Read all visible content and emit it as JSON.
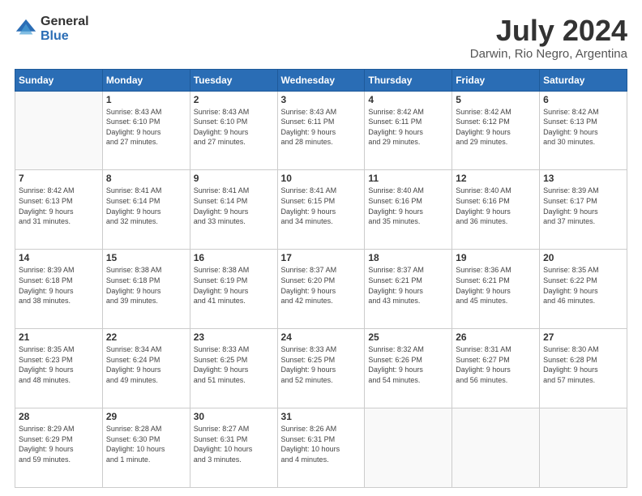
{
  "header": {
    "logo_general": "General",
    "logo_blue": "Blue",
    "title": "July 2024",
    "subtitle": "Darwin, Rio Negro, Argentina"
  },
  "days_of_week": [
    "Sunday",
    "Monday",
    "Tuesday",
    "Wednesday",
    "Thursday",
    "Friday",
    "Saturday"
  ],
  "weeks": [
    [
      {
        "day": "",
        "info": ""
      },
      {
        "day": "1",
        "info": "Sunrise: 8:43 AM\nSunset: 6:10 PM\nDaylight: 9 hours\nand 27 minutes."
      },
      {
        "day": "2",
        "info": "Sunrise: 8:43 AM\nSunset: 6:10 PM\nDaylight: 9 hours\nand 27 minutes."
      },
      {
        "day": "3",
        "info": "Sunrise: 8:43 AM\nSunset: 6:11 PM\nDaylight: 9 hours\nand 28 minutes."
      },
      {
        "day": "4",
        "info": "Sunrise: 8:42 AM\nSunset: 6:11 PM\nDaylight: 9 hours\nand 29 minutes."
      },
      {
        "day": "5",
        "info": "Sunrise: 8:42 AM\nSunset: 6:12 PM\nDaylight: 9 hours\nand 29 minutes."
      },
      {
        "day": "6",
        "info": "Sunrise: 8:42 AM\nSunset: 6:13 PM\nDaylight: 9 hours\nand 30 minutes."
      }
    ],
    [
      {
        "day": "7",
        "info": "Sunrise: 8:42 AM\nSunset: 6:13 PM\nDaylight: 9 hours\nand 31 minutes."
      },
      {
        "day": "8",
        "info": "Sunrise: 8:41 AM\nSunset: 6:14 PM\nDaylight: 9 hours\nand 32 minutes."
      },
      {
        "day": "9",
        "info": "Sunrise: 8:41 AM\nSunset: 6:14 PM\nDaylight: 9 hours\nand 33 minutes."
      },
      {
        "day": "10",
        "info": "Sunrise: 8:41 AM\nSunset: 6:15 PM\nDaylight: 9 hours\nand 34 minutes."
      },
      {
        "day": "11",
        "info": "Sunrise: 8:40 AM\nSunset: 6:16 PM\nDaylight: 9 hours\nand 35 minutes."
      },
      {
        "day": "12",
        "info": "Sunrise: 8:40 AM\nSunset: 6:16 PM\nDaylight: 9 hours\nand 36 minutes."
      },
      {
        "day": "13",
        "info": "Sunrise: 8:39 AM\nSunset: 6:17 PM\nDaylight: 9 hours\nand 37 minutes."
      }
    ],
    [
      {
        "day": "14",
        "info": "Sunrise: 8:39 AM\nSunset: 6:18 PM\nDaylight: 9 hours\nand 38 minutes."
      },
      {
        "day": "15",
        "info": "Sunrise: 8:38 AM\nSunset: 6:18 PM\nDaylight: 9 hours\nand 39 minutes."
      },
      {
        "day": "16",
        "info": "Sunrise: 8:38 AM\nSunset: 6:19 PM\nDaylight: 9 hours\nand 41 minutes."
      },
      {
        "day": "17",
        "info": "Sunrise: 8:37 AM\nSunset: 6:20 PM\nDaylight: 9 hours\nand 42 minutes."
      },
      {
        "day": "18",
        "info": "Sunrise: 8:37 AM\nSunset: 6:21 PM\nDaylight: 9 hours\nand 43 minutes."
      },
      {
        "day": "19",
        "info": "Sunrise: 8:36 AM\nSunset: 6:21 PM\nDaylight: 9 hours\nand 45 minutes."
      },
      {
        "day": "20",
        "info": "Sunrise: 8:35 AM\nSunset: 6:22 PM\nDaylight: 9 hours\nand 46 minutes."
      }
    ],
    [
      {
        "day": "21",
        "info": "Sunrise: 8:35 AM\nSunset: 6:23 PM\nDaylight: 9 hours\nand 48 minutes."
      },
      {
        "day": "22",
        "info": "Sunrise: 8:34 AM\nSunset: 6:24 PM\nDaylight: 9 hours\nand 49 minutes."
      },
      {
        "day": "23",
        "info": "Sunrise: 8:33 AM\nSunset: 6:25 PM\nDaylight: 9 hours\nand 51 minutes."
      },
      {
        "day": "24",
        "info": "Sunrise: 8:33 AM\nSunset: 6:25 PM\nDaylight: 9 hours\nand 52 minutes."
      },
      {
        "day": "25",
        "info": "Sunrise: 8:32 AM\nSunset: 6:26 PM\nDaylight: 9 hours\nand 54 minutes."
      },
      {
        "day": "26",
        "info": "Sunrise: 8:31 AM\nSunset: 6:27 PM\nDaylight: 9 hours\nand 56 minutes."
      },
      {
        "day": "27",
        "info": "Sunrise: 8:30 AM\nSunset: 6:28 PM\nDaylight: 9 hours\nand 57 minutes."
      }
    ],
    [
      {
        "day": "28",
        "info": "Sunrise: 8:29 AM\nSunset: 6:29 PM\nDaylight: 9 hours\nand 59 minutes."
      },
      {
        "day": "29",
        "info": "Sunrise: 8:28 AM\nSunset: 6:30 PM\nDaylight: 10 hours\nand 1 minute."
      },
      {
        "day": "30",
        "info": "Sunrise: 8:27 AM\nSunset: 6:31 PM\nDaylight: 10 hours\nand 3 minutes."
      },
      {
        "day": "31",
        "info": "Sunrise: 8:26 AM\nSunset: 6:31 PM\nDaylight: 10 hours\nand 4 minutes."
      },
      {
        "day": "",
        "info": ""
      },
      {
        "day": "",
        "info": ""
      },
      {
        "day": "",
        "info": ""
      }
    ]
  ]
}
